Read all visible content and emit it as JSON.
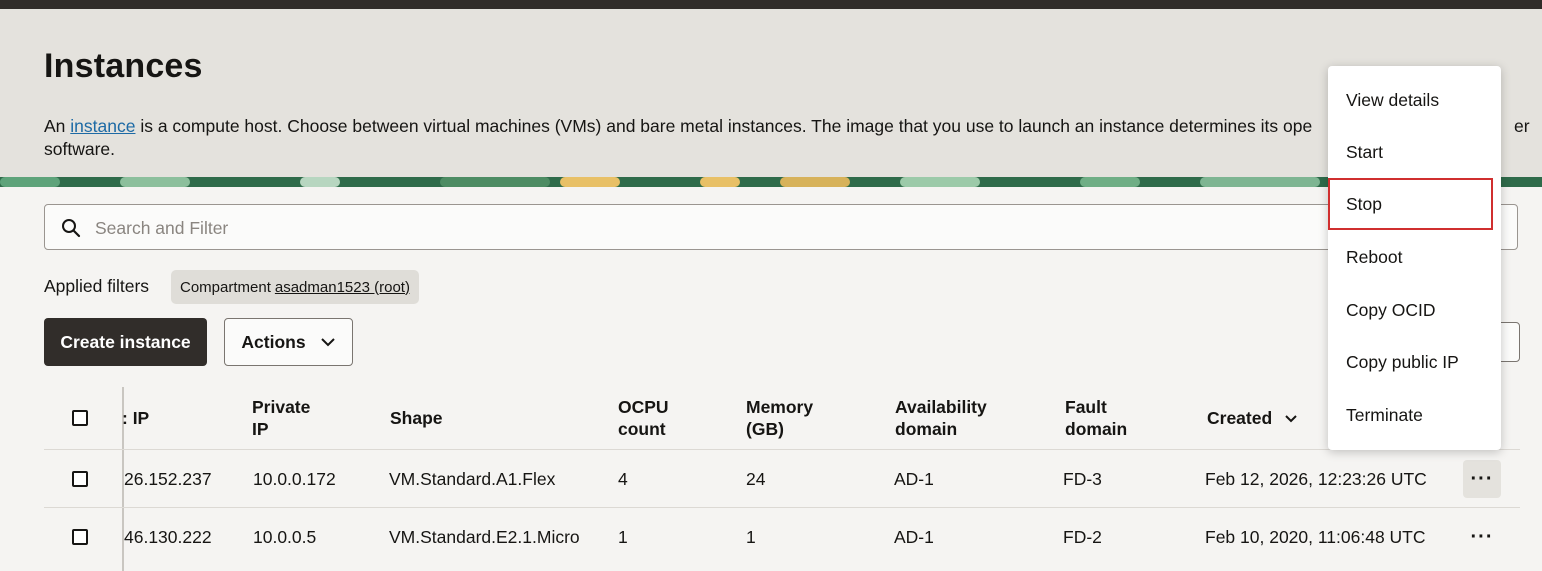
{
  "page": {
    "title": "Instances",
    "description_prefix": "An ",
    "description_link": "instance",
    "description_suffix": " is a compute host. Choose between virtual machines (VMs) and bare metal instances. The image that you use to launch an instance determines its ope"
  },
  "description_trailing_1": "er",
  "description_trailing_2": "software.",
  "search": {
    "placeholder": "Search and Filter"
  },
  "filters": {
    "label": "Applied filters",
    "chip_key": "Compartment",
    "chip_value": "asadman1523 (root)"
  },
  "toolbar": {
    "create_label": "Create instance",
    "actions_label": "Actions"
  },
  "table": {
    "headers": {
      "public_ip": ": IP",
      "private_ip_1": "Private",
      "private_ip_2": "IP",
      "shape": "Shape",
      "ocpu_1": "OCPU",
      "ocpu_2": "count",
      "memory_1": "Memory",
      "memory_2": "(GB)",
      "availability_1": "Availability",
      "availability_2": "domain",
      "fault_1": "Fault",
      "fault_2": "domain",
      "created": "Created"
    },
    "rows": [
      {
        "public_ip": "26.152.237",
        "private_ip": "10.0.0.172",
        "shape": "VM.Standard.A1.Flex",
        "ocpu": "4",
        "memory": "24",
        "ad": "AD-1",
        "fd": "FD-3",
        "created": "Feb 12, 2026, 12:23:26 UTC"
      },
      {
        "public_ip": "46.130.222",
        "private_ip": "10.0.0.5",
        "shape": "VM.Standard.E2.1.Micro",
        "ocpu": "1",
        "memory": "1",
        "ad": "AD-1",
        "fd": "FD-2",
        "created": "Feb 10, 2020, 11:06:48 UTC"
      }
    ]
  },
  "menu": {
    "items": [
      "View details",
      "Start",
      "Stop",
      "Reboot",
      "Copy OCID",
      "Copy public IP",
      "Terminate"
    ],
    "highlighted": "Stop"
  },
  "colors": {
    "accent_highlight": "#d02f2f",
    "primary_button": "#312d2a",
    "link": "#1d6aa5"
  },
  "icons": [
    "search-icon",
    "chevron-down-icon",
    "more-actions-icon"
  ]
}
